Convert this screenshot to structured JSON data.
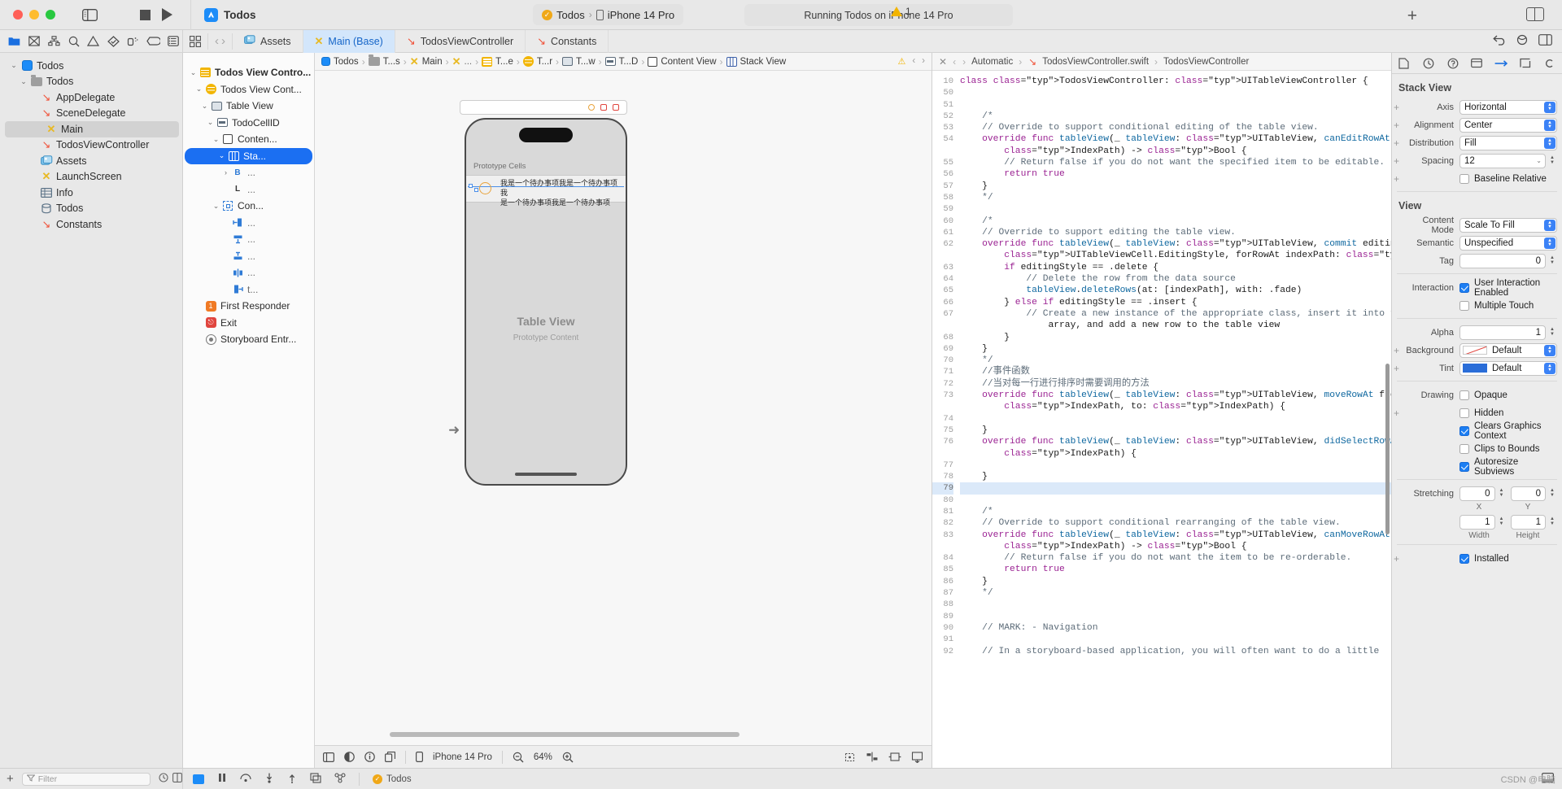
{
  "titlebar": {
    "project_name": "Todos",
    "scheme": "Todos",
    "destination": "iPhone 14 Pro",
    "status": "Running Todos on iPhone 14 Pro",
    "warning_count": "1",
    "add_label": "+"
  },
  "tabs": [
    {
      "label": "Assets",
      "icon": "assets-icon",
      "selected": false
    },
    {
      "label": "Main (Base)",
      "icon": "interface-builder-icon",
      "selected": true
    },
    {
      "label": "TodosViewController",
      "icon": "swift-icon",
      "selected": false
    },
    {
      "label": "Constants",
      "icon": "swift-icon",
      "selected": false
    }
  ],
  "navigator": {
    "filter_placeholder": "Filter",
    "items": [
      {
        "label": "Todos",
        "icon": "app-icon",
        "depth": 0,
        "twisty": "down",
        "selected": false
      },
      {
        "label": "Todos",
        "icon": "folder-icon",
        "depth": 1,
        "twisty": "down",
        "selected": false
      },
      {
        "label": "AppDelegate",
        "icon": "swift-icon",
        "depth": 2,
        "twisty": "",
        "selected": false
      },
      {
        "label": "SceneDelegate",
        "icon": "swift-icon",
        "depth": 2,
        "twisty": "",
        "selected": false
      },
      {
        "label": "Main",
        "icon": "interface-builder-icon",
        "depth": 2,
        "twisty": "",
        "selected": true
      },
      {
        "label": "TodosViewController",
        "icon": "swift-icon",
        "depth": 2,
        "twisty": "",
        "selected": false
      },
      {
        "label": "Assets",
        "icon": "assets-icon",
        "depth": 2,
        "twisty": "",
        "selected": false
      },
      {
        "label": "LaunchScreen",
        "icon": "interface-builder-icon",
        "depth": 2,
        "twisty": "",
        "selected": false
      },
      {
        "label": "Info",
        "icon": "plist-icon",
        "depth": 2,
        "twisty": "",
        "selected": false
      },
      {
        "label": "Todos",
        "icon": "coredata-icon",
        "depth": 2,
        "twisty": "",
        "selected": false
      },
      {
        "label": "Constants",
        "icon": "swift-icon",
        "depth": 2,
        "twisty": "",
        "selected": false
      }
    ]
  },
  "outline": {
    "items": [
      {
        "label": "Todos View Contro...",
        "icon": "scene-icon",
        "depth": 0,
        "twisty": "down",
        "selected": false,
        "badge": true
      },
      {
        "label": "Todos View Cont...",
        "icon": "viewcontroller-icon",
        "depth": 1,
        "twisty": "down",
        "selected": false
      },
      {
        "label": "Table View",
        "icon": "tableview-icon",
        "depth": 2,
        "twisty": "down",
        "selected": false
      },
      {
        "label": "TodoCellID",
        "icon": "tableviewcell-icon",
        "depth": 3,
        "twisty": "down",
        "selected": false
      },
      {
        "label": "Conten...",
        "icon": "view-icon",
        "depth": 4,
        "twisty": "down",
        "selected": false
      },
      {
        "label": "Sta...",
        "icon": "stackview-icon",
        "depth": 5,
        "twisty": "down",
        "selected": true
      },
      {
        "label": "...",
        "icon": "button-icon",
        "depth": 6,
        "twisty": "right",
        "selected": false
      },
      {
        "label": "...",
        "icon": "label-icon",
        "depth": 6,
        "twisty": "",
        "selected": false
      },
      {
        "label": "Con...",
        "icon": "constraints-icon",
        "depth": 4,
        "twisty": "down",
        "selected": false
      },
      {
        "label": "...",
        "icon": "constraint-leading-icon",
        "depth": 5,
        "twisty": "",
        "selected": false
      },
      {
        "label": "...",
        "icon": "constraint-top-icon",
        "depth": 5,
        "twisty": "",
        "selected": false
      },
      {
        "label": "...",
        "icon": "constraint-bottom-icon",
        "depth": 5,
        "twisty": "",
        "selected": false
      },
      {
        "label": "...",
        "icon": "constraint-center-icon",
        "depth": 5,
        "twisty": "",
        "selected": false
      },
      {
        "label": "t...",
        "icon": "constraint-trailing-icon",
        "depth": 5,
        "twisty": "",
        "selected": false
      },
      {
        "label": "First Responder",
        "icon": "first-responder-icon",
        "depth": 1,
        "twisty": "",
        "selected": false
      },
      {
        "label": "Exit",
        "icon": "exit-icon",
        "depth": 1,
        "twisty": "",
        "selected": false
      },
      {
        "label": "Storyboard Entr...",
        "icon": "storyboard-entry-icon",
        "depth": 1,
        "twisty": "",
        "selected": false
      }
    ]
  },
  "breadcrumb": {
    "items": [
      {
        "label": "Todos",
        "icon": "app-icon"
      },
      {
        "label": "T...s",
        "icon": "folder-icon"
      },
      {
        "label": "Main",
        "icon": "interface-builder-icon"
      },
      {
        "label": "...",
        "icon": "interface-builder-icon"
      },
      {
        "label": "T...e",
        "icon": "scene-icon"
      },
      {
        "label": "T...r",
        "icon": "viewcontroller-icon"
      },
      {
        "label": "T...w",
        "icon": "tableview-icon"
      },
      {
        "label": "T...D",
        "icon": "tableviewcell-icon"
      },
      {
        "label": "Content View",
        "icon": "view-icon"
      },
      {
        "label": "Stack View",
        "icon": "stackview-icon"
      }
    ]
  },
  "canvas": {
    "prototype_cells_label": "Prototype Cells",
    "cell_text_line1": "我是一个待办事项我是一个待办事项我",
    "cell_text_line2": "是一个待办事项我是一个待办事项",
    "table_view_title": "Table View",
    "table_view_subtitle": "Prototype Content",
    "device_label": "iPhone 14 Pro",
    "zoom_level": "64%"
  },
  "editor": {
    "crumb_automatic": "Automatic",
    "crumb_file": "TodosViewController.swift",
    "crumb_symbol": "TodosViewController",
    "first_line_number": 10,
    "lines": [
      {
        "n": 10,
        "text": "class TodosViewController: UITableViewController {",
        "hl": false
      },
      {
        "n": 50,
        "text": "",
        "hl": false
      },
      {
        "n": 51,
        "text": "",
        "hl": false
      },
      {
        "n": 52,
        "text": "    /*",
        "hl": false
      },
      {
        "n": 53,
        "text": "    // Override to support conditional editing of the table view.",
        "hl": false
      },
      {
        "n": 54,
        "text": "    override func tableView(_ tableView: UITableView, canEditRowAt indexPath:",
        "hl": false
      },
      {
        "n": "",
        "text": "        IndexPath) -> Bool {",
        "hl": false
      },
      {
        "n": 55,
        "text": "        // Return false if you do not want the specified item to be editable.",
        "hl": false
      },
      {
        "n": 56,
        "text": "        return true",
        "hl": false
      },
      {
        "n": 57,
        "text": "    }",
        "hl": false
      },
      {
        "n": 58,
        "text": "    */",
        "hl": false
      },
      {
        "n": 59,
        "text": "",
        "hl": false
      },
      {
        "n": 60,
        "text": "    /*",
        "hl": false
      },
      {
        "n": 61,
        "text": "    // Override to support editing the table view.",
        "hl": false
      },
      {
        "n": 62,
        "text": "    override func tableView(_ tableView: UITableView, commit editingStyle:",
        "hl": false
      },
      {
        "n": "",
        "text": "        UITableViewCell.EditingStyle, forRowAt indexPath: IndexPath) {",
        "hl": false
      },
      {
        "n": 63,
        "text": "        if editingStyle == .delete {",
        "hl": false
      },
      {
        "n": 64,
        "text": "            // Delete the row from the data source",
        "hl": false
      },
      {
        "n": 65,
        "text": "            tableView.deleteRows(at: [indexPath], with: .fade)",
        "hl": false
      },
      {
        "n": 66,
        "text": "        } else if editingStyle == .insert {",
        "hl": false
      },
      {
        "n": 67,
        "text": "            // Create a new instance of the appropriate class, insert it into the",
        "hl": false
      },
      {
        "n": "",
        "text": "                array, and add a new row to the table view",
        "hl": false
      },
      {
        "n": 68,
        "text": "        }",
        "hl": false
      },
      {
        "n": 69,
        "text": "    }",
        "hl": false
      },
      {
        "n": 70,
        "text": "    */",
        "hl": false
      },
      {
        "n": 71,
        "text": "    //事件函数",
        "hl": false
      },
      {
        "n": 72,
        "text": "    //当对每一行进行排序时需要调用的方法",
        "hl": false
      },
      {
        "n": 73,
        "text": "    override func tableView(_ tableView: UITableView, moveRowAt fromIndexPath:",
        "hl": false
      },
      {
        "n": "",
        "text": "        IndexPath, to: IndexPath) {",
        "hl": false
      },
      {
        "n": 74,
        "text": "",
        "hl": false
      },
      {
        "n": 75,
        "text": "    }",
        "hl": false
      },
      {
        "n": 76,
        "text": "    override func tableView(_ tableView: UITableView, didSelectRowAt indexPath:",
        "hl": false
      },
      {
        "n": "",
        "text": "        IndexPath) {",
        "hl": false
      },
      {
        "n": 77,
        "text": "",
        "hl": false
      },
      {
        "n": 78,
        "text": "    }",
        "hl": false
      },
      {
        "n": 79,
        "text": "",
        "hl": true
      },
      {
        "n": 80,
        "text": "",
        "hl": false
      },
      {
        "n": 81,
        "text": "    /*",
        "hl": false
      },
      {
        "n": 82,
        "text": "    // Override to support conditional rearranging of the table view.",
        "hl": false
      },
      {
        "n": 83,
        "text": "    override func tableView(_ tableView: UITableView, canMoveRowAt indexPath:",
        "hl": false
      },
      {
        "n": "",
        "text": "        IndexPath) -> Bool {",
        "hl": false
      },
      {
        "n": 84,
        "text": "        // Return false if you do not want the item to be re-orderable.",
        "hl": false
      },
      {
        "n": 85,
        "text": "        return true",
        "hl": false
      },
      {
        "n": 86,
        "text": "    }",
        "hl": false
      },
      {
        "n": 87,
        "text": "    */",
        "hl": false
      },
      {
        "n": 88,
        "text": "",
        "hl": false
      },
      {
        "n": 89,
        "text": "",
        "hl": false
      },
      {
        "n": 90,
        "text": "    // MARK: - Navigation",
        "hl": false
      },
      {
        "n": 91,
        "text": "",
        "hl": false
      },
      {
        "n": 92,
        "text": "    // In a storyboard-based application, you will often want to do a little",
        "hl": false
      }
    ]
  },
  "inspector": {
    "section_stack_view": "Stack View",
    "section_view": "View",
    "axis_label": "Axis",
    "axis_value": "Horizontal",
    "alignment_label": "Alignment",
    "alignment_value": "Center",
    "distribution_label": "Distribution",
    "distribution_value": "Fill",
    "spacing_label": "Spacing",
    "spacing_value": "12",
    "baseline_relative_label": "Baseline Relative",
    "baseline_relative_checked": false,
    "content_mode_label": "Content Mode",
    "content_mode_value": "Scale To Fill",
    "semantic_label": "Semantic",
    "semantic_value": "Unspecified",
    "tag_label": "Tag",
    "tag_value": "0",
    "interaction_label": "Interaction",
    "user_interaction_label": "User Interaction Enabled",
    "user_interaction_checked": true,
    "multiple_touch_label": "Multiple Touch",
    "multiple_touch_checked": false,
    "alpha_label": "Alpha",
    "alpha_value": "1",
    "background_label": "Background",
    "background_value": "Default",
    "tint_label": "Tint",
    "tint_value": "Default",
    "tint_color": "#2a6dd8",
    "drawing_label": "Drawing",
    "opaque_label": "Opaque",
    "opaque_checked": false,
    "hidden_label": "Hidden",
    "hidden_checked": false,
    "clears_graphics_label": "Clears Graphics Context",
    "clears_graphics_checked": true,
    "clips_bounds_label": "Clips to Bounds",
    "clips_bounds_checked": false,
    "autoresize_label": "Autoresize Subviews",
    "autoresize_checked": true,
    "stretching_label": "Stretching",
    "stretch_x": "0",
    "stretch_y": "0",
    "stretch_x_label": "X",
    "stretch_y_label": "Y",
    "stretch_width": "1",
    "stretch_height": "1",
    "stretch_width_label": "Width",
    "stretch_height_label": "Height",
    "installed_label": "Installed",
    "installed_checked": true
  },
  "bottombar": {
    "filter_placeholder": "Filter",
    "scheme_label": "Todos",
    "watermark": "CSDN @电脑"
  }
}
